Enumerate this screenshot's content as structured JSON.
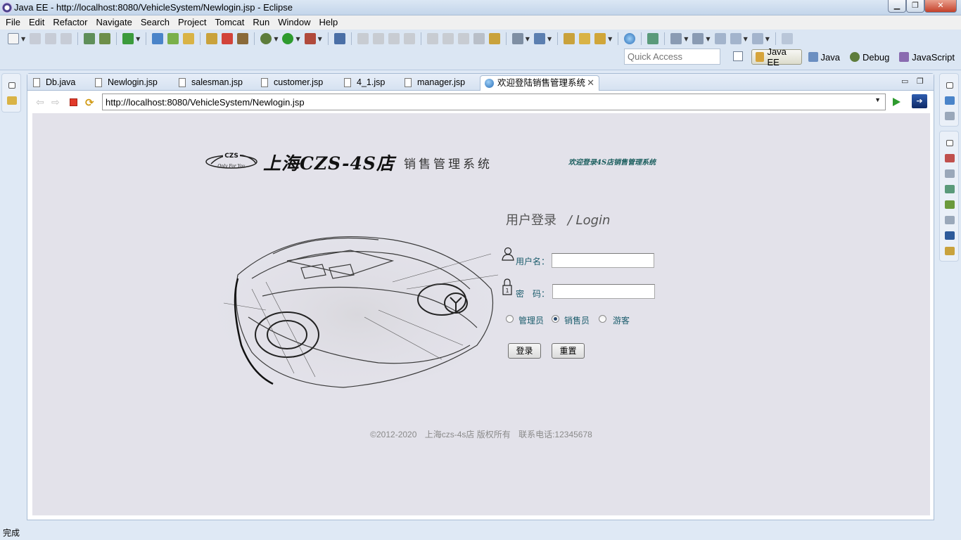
{
  "window": {
    "title": "Java EE - http://localhost:8080/VehicleSystem/Newlogin.jsp - Eclipse"
  },
  "menu": [
    "File",
    "Edit",
    "Refactor",
    "Navigate",
    "Search",
    "Project",
    "Tomcat",
    "Run",
    "Window",
    "Help"
  ],
  "toolbar": {
    "quick_access_placeholder": "Quick Access",
    "perspectives": [
      {
        "label": "Java EE",
        "active": true
      },
      {
        "label": "Java",
        "active": false
      },
      {
        "label": "Debug",
        "active": false
      },
      {
        "label": "JavaScript",
        "active": false
      }
    ]
  },
  "tabs": [
    {
      "label": "Db.java"
    },
    {
      "label": "Newlogin.jsp"
    },
    {
      "label": "salesman.jsp"
    },
    {
      "label": "customer.jsp"
    },
    {
      "label": "4_1.jsp"
    },
    {
      "label": "manager.jsp"
    },
    {
      "label": "欢迎登陆销售管理系统",
      "active": true
    }
  ],
  "browser": {
    "url": "http://localhost:8080/VehicleSystem/Newlogin.jsp"
  },
  "page": {
    "logo_badge": "CZS",
    "logo_tagline": "Only For You",
    "logo_title": "上海CZS-4S店",
    "logo_subtitle": "销售管理系统",
    "welcome": "欢迎登录4S店销售管理系统",
    "login_heading_cn": "用户登录",
    "login_heading_sep": "/",
    "login_heading_en": "Login",
    "username_label": "用户名：",
    "password_label": "密　码：",
    "roles": [
      {
        "label": "管理员",
        "checked": false
      },
      {
        "label": "销售员",
        "checked": true
      },
      {
        "label": "游客",
        "checked": false
      }
    ],
    "login_button": "登录",
    "reset_button": "重置",
    "footer_copyright": "©2012-2020",
    "footer_owner": "上海czs-4s店 版权所有",
    "footer_phone": "联系电话:12345678"
  },
  "status": "完成"
}
